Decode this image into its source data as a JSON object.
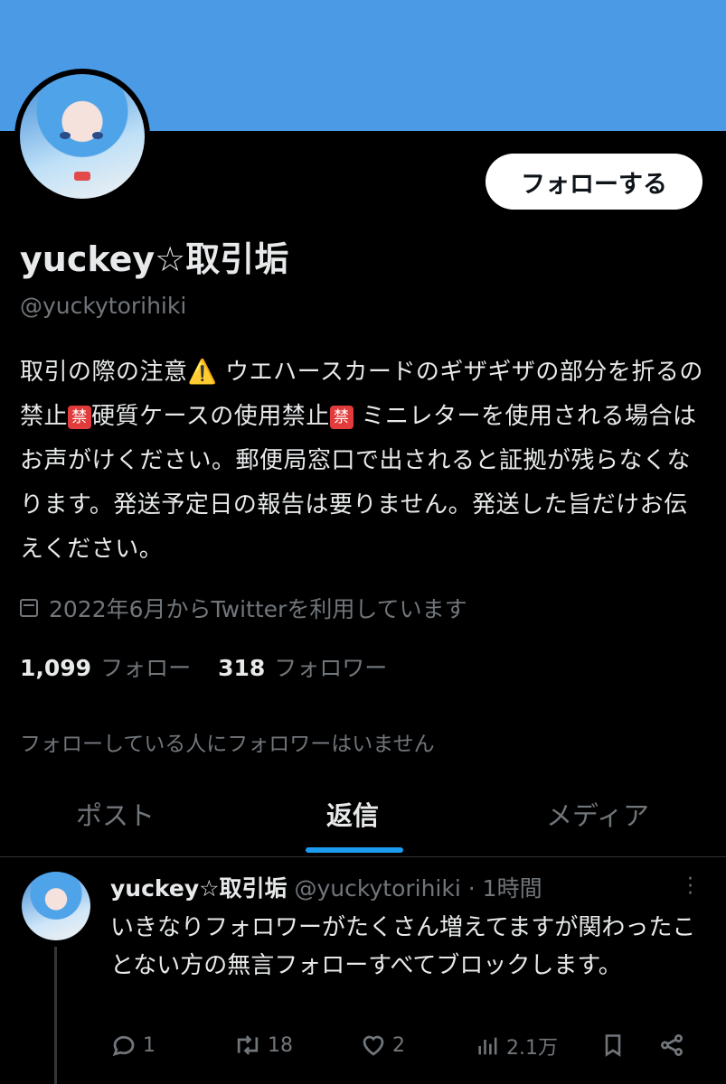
{
  "profile": {
    "name": "yuckey☆取引垢",
    "handle": "@yuckytorihiki",
    "follow_button": "フォローする",
    "bio_parts": {
      "p1": "取引の際の注意",
      "warn": "⚠️",
      "p2": " ウエハースカードのギザギザの部分を折るの禁止",
      "ban1": "禁",
      "p3": "硬質ケースの使用禁止",
      "ban2": "禁",
      "p4": " ミニレターを使用される場合はお声がけください。郵便局窓口で出されると証拠が残らなくなります。発送予定日の報告は要りません。発送した旨だけお伝えください。"
    },
    "joined": "2022年6月からTwitterを利用しています",
    "following_count": "1,099",
    "following_label": "フォロー",
    "followers_count": "318",
    "followers_label": "フォロワー",
    "mutual_note": "フォローしている人にフォロワーはいません"
  },
  "tabs": [
    {
      "label": "ポスト"
    },
    {
      "label": "返信"
    },
    {
      "label": "メディア"
    }
  ],
  "active_tab": "返信",
  "tweet": {
    "name": "yuckey☆取引垢",
    "handle": "@yuckytorihiki",
    "separator": "·",
    "time": "1時間",
    "text": "いきなりフォロワーがたくさん増えてますが関わったことない方の無言フォローすべてブロックします。",
    "replies": "1",
    "retweets": "18",
    "likes": "2",
    "views": "2.1万"
  },
  "icons": [
    "calendar-icon",
    "reply-icon",
    "retweet-icon",
    "like-icon",
    "views-icon",
    "bookmark-icon",
    "share-icon",
    "more-icon"
  ],
  "colors": {
    "banner": "#4a9ae6",
    "accent": "#1d9bf0",
    "background": "#000000",
    "muted": "#71767b"
  }
}
